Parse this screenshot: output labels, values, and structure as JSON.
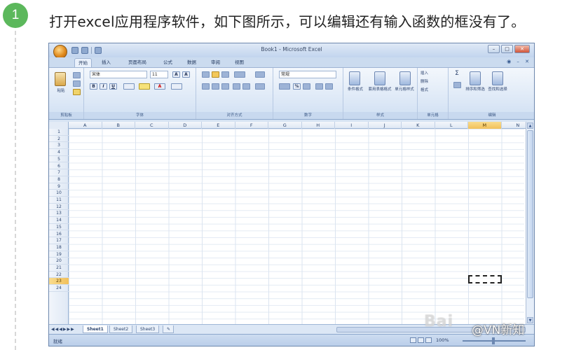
{
  "step": {
    "number": "1",
    "instruction": "打开excel应用程序软件，如下图所示，可以编辑还有输入函数的框没有了。"
  },
  "excel": {
    "window_title": "Book1 - Microsoft Excel",
    "tabs": [
      "开始",
      "插入",
      "页面布局",
      "公式",
      "数据",
      "审阅",
      "视图"
    ],
    "active_tab": "开始",
    "ribbon": {
      "clipboard": {
        "label": "剪贴板",
        "paste": "粘贴"
      },
      "font": {
        "label": "字体",
        "font_name": "宋体",
        "font_size": "11",
        "bold": "B",
        "italic": "I",
        "underline": "U",
        "font_color": "A"
      },
      "alignment": {
        "label": "对齐方式"
      },
      "number": {
        "label": "数字",
        "format": "常规",
        "percent": "%"
      },
      "styles": {
        "label": "样式",
        "conditional": "条件格式",
        "table": "套用表格格式",
        "cell_styles": "单元格样式"
      },
      "cells": {
        "label": "单元格",
        "insert": "插入",
        "delete": "删除",
        "format": "格式"
      },
      "editing": {
        "label": "编辑",
        "sort": "排序和筛选",
        "find": "查找和选择",
        "sigma": "Σ"
      }
    },
    "columns": [
      "A",
      "B",
      "C",
      "D",
      "E",
      "F",
      "G",
      "H",
      "I",
      "J",
      "K",
      "L",
      "M",
      "N"
    ],
    "selected_column": "M",
    "rows": [
      "1",
      "2",
      "3",
      "4",
      "5",
      "6",
      "7",
      "8",
      "9",
      "10",
      "11",
      "12",
      "13",
      "14",
      "15",
      "16",
      "17",
      "18",
      "19",
      "20",
      "21",
      "22",
      "23",
      "24"
    ],
    "selected_row": "23",
    "sheets": [
      "Sheet1",
      "Sheet2",
      "Sheet3"
    ],
    "active_sheet": "Sheet1",
    "status": "就绪",
    "zoom": "100%"
  },
  "watermark": "Bai",
  "attribution": "@VN新知"
}
